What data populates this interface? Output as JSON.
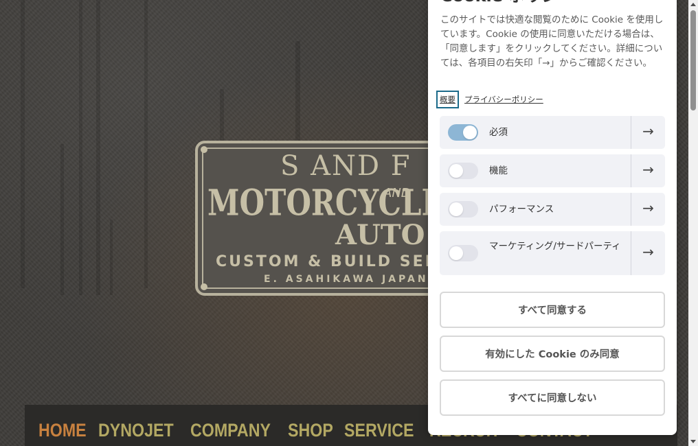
{
  "site": {
    "sign": {
      "brand": "S AND F",
      "line1": "MOTORCYCLE",
      "and_mark": "AND",
      "line2": "AUTO M",
      "tagline": "CUSTOM & BUILD SER",
      "place": "E. ASAHIKAWA JAPAN"
    },
    "nav": [
      "HOME",
      "DYNOJET",
      "COMPANY",
      "SHOP",
      "SERVICE",
      "RECRUIT",
      "CONTACT"
    ],
    "nav_active": "HOME"
  },
  "cookie": {
    "title": "Cookie ポリシ",
    "description": "このサイトでは快適な閲覧のために Cookie を使用しています。Cookie の使用に同意いただける場合は、「同意します」をクリックしてください。詳細については、各項目の右矢印「→」からご確認ください。",
    "links": {
      "overview": "概要",
      "privacy": "プライバシーポリシー"
    },
    "categories": [
      {
        "label": "必須",
        "enabled": true
      },
      {
        "label": "機能",
        "enabled": false
      },
      {
        "label": "パフォーマンス",
        "enabled": false
      },
      {
        "label": "マーケティング/サードパーティ",
        "enabled": false
      }
    ],
    "arrow_icon": "arrow-right-icon",
    "buttons": {
      "accept_all": "すべて同意する",
      "accept_selected": "有効にした Cookie のみ同意",
      "reject_all": "すべてに同意しない"
    },
    "colors": {
      "toggle_on": "#8db6d5",
      "toggle_off": "#e2e3ea",
      "focus_outline": "#1b6a8a"
    }
  }
}
